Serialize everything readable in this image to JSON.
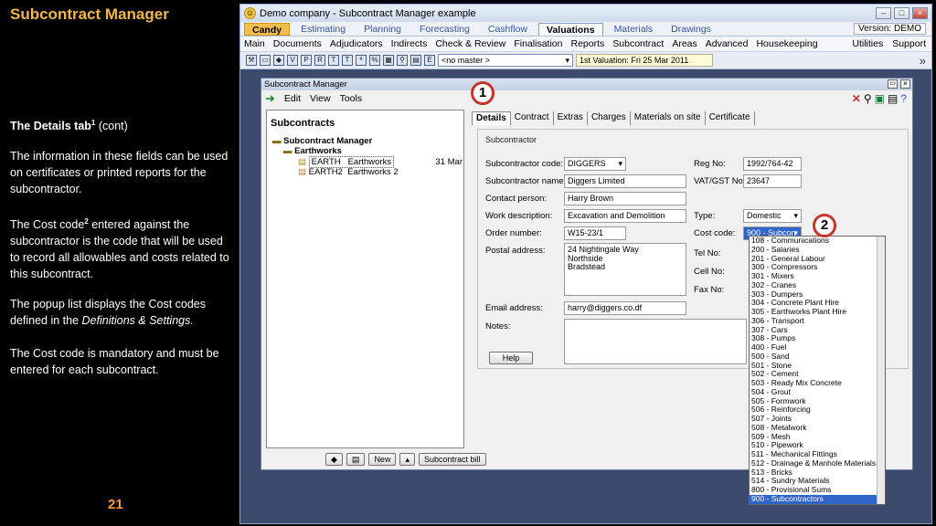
{
  "slide": {
    "title": "Subcontract Manager",
    "heading": "The Details tab",
    "heading_sup": "1",
    "heading_tail": "(cont)",
    "para1": "The information in these fields can be used on certificates or printed reports for the subcontractor.",
    "para2_a": "The Cost code",
    "para2_sup": "2",
    "para2_b": "entered against the subcontractor is the code that will be used to record all allowables and costs related to this subcontract.",
    "para3_a": "The popup list displays the Cost codes defined in the",
    "para3_em": "Definitions & Settings.",
    "para4": "The Cost code is mandatory and must be entered for each subcontract.",
    "page_number": "21"
  },
  "app": {
    "window_title": "Demo company - Subcontract Manager example",
    "modules": [
      "Candy",
      "Estimating",
      "Planning",
      "Forecasting",
      "Cashflow",
      "Valuations",
      "Materials",
      "Drawings"
    ],
    "version": "Version: DEMO",
    "menu": [
      "Main",
      "Documents",
      "Adjudicators",
      "Indirects",
      "Check & Review",
      "Finalisation",
      "Reports",
      "Subcontract",
      "Areas",
      "Advanced",
      "Housekeeping"
    ],
    "menu_right": [
      "Utilities",
      "Support"
    ],
    "master_select": "<no master >",
    "valuation_field": "1st Valuation: Fri 25 Mar 2011"
  },
  "inner": {
    "title": "Subcontract Manager",
    "menu": [
      "Edit",
      "View",
      "Tools"
    ],
    "tree_heading": "Subcontracts",
    "tree_root": "Subcontract Manager",
    "tree_group": "Earthworks",
    "tree_items": [
      {
        "code": "EARTH",
        "name": "Earthworks",
        "date": "31 Mar"
      },
      {
        "code": "EARTH2",
        "name": "Earthworks 2",
        "date": ""
      }
    ],
    "buttons": {
      "new": "New",
      "bill": "Subcontract bill"
    }
  },
  "details": {
    "tabs": [
      "Details",
      "Contract",
      "Extras",
      "Charges",
      "Materials on site",
      "Certificate"
    ],
    "section": "Subcontractor",
    "labels": {
      "code": "Subcontractor code:",
      "name": "Subcontractor name:",
      "contact": "Contact person:",
      "work": "Work description:",
      "order": "Order number:",
      "postal": "Postal address:",
      "email": "Email address:",
      "notes": "Notes:",
      "reg": "Reg No:",
      "vat": "VAT/GST No:",
      "type": "Type:",
      "cost": "Cost code:",
      "tel": "Tel No:",
      "cell": "Cell No:",
      "fax": "Fax No:"
    },
    "values": {
      "code": "DIGGERS",
      "name": "Diggers Limited",
      "contact": "Harry Brown",
      "work": "Excavation and Demolition",
      "order": "W15-23/1",
      "postal1": "24 Nightingale Way",
      "postal2": "Northside",
      "postal3": "Bradstead",
      "email": "harry@diggers.co.df",
      "reg": "1992/764-42",
      "vat": "23647",
      "type": "Domestic",
      "cost": "900 - Subcon"
    },
    "help": "Help"
  },
  "cost_codes": [
    "108 - Communications",
    "200 - Salaries",
    "201 - General Labour",
    "300 - Compressors",
    "301 - Mixers",
    "302 - Cranes",
    "303 - Dumpers",
    "304 - Concrete Plant Hire",
    "305 - Earthworks Plant Hire",
    "306 - Transport",
    "307 - Cars",
    "308 - Pumps",
    "400 - Fuel",
    "500 - Sand",
    "501 - Stone",
    "502 - Cement",
    "503 - Ready Mix Concrete",
    "504 - Grout",
    "505 - Formwork",
    "506 - Reinforcing",
    "507 - Joints",
    "508 - Metalwork",
    "509 - Mesh",
    "510 - Pipework",
    "511 - Mechanical Fittings",
    "512 - Drainage & Manhole Materials",
    "513 - Bricks",
    "514 - Sundry Materials",
    "800 - Provisional Sums",
    "900 - Subcontractors"
  ],
  "callouts": [
    "1",
    "2"
  ]
}
